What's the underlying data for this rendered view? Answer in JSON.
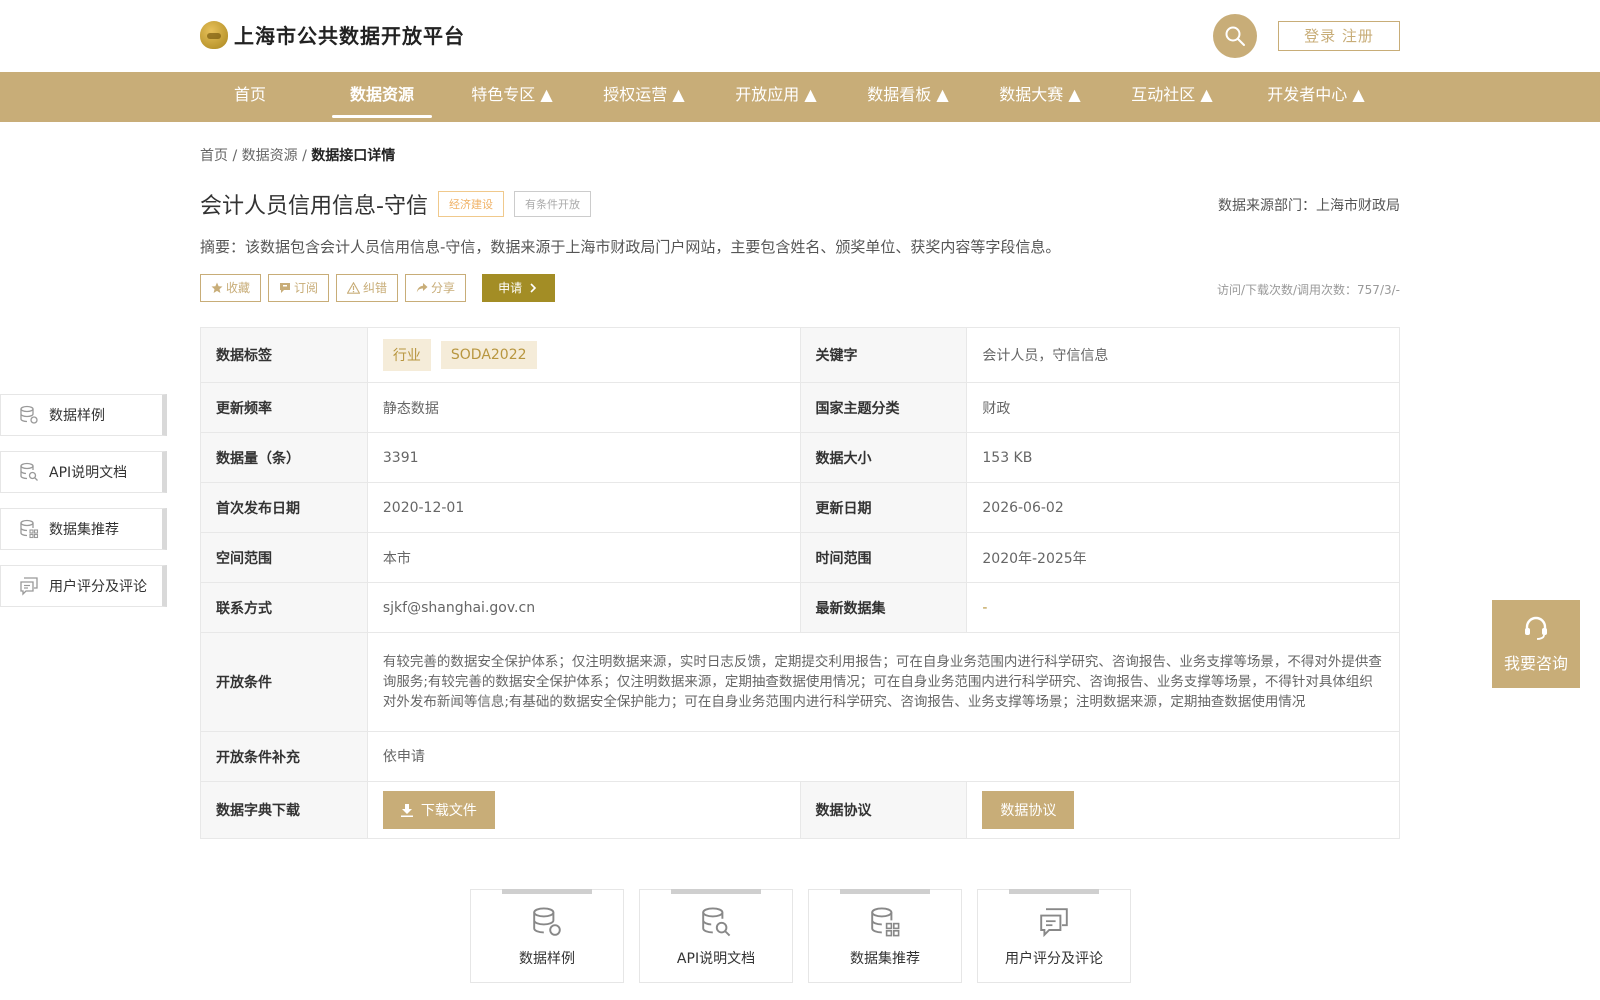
{
  "header": {
    "logo_text": "上海市公共数据开放平台",
    "login_label": "登录 注册"
  },
  "nav": [
    {
      "label": "首页"
    },
    {
      "label": "数据资源"
    },
    {
      "label": "特色专区 ▲"
    },
    {
      "label": "授权运营 ▲"
    },
    {
      "label": "开放应用 ▲"
    },
    {
      "label": "数据看板 ▲"
    },
    {
      "label": "数据大赛 ▲"
    },
    {
      "label": "互动社区 ▲"
    },
    {
      "label": "开发者中心 ▲"
    }
  ],
  "breadcrumb": {
    "home": "首页",
    "sep": " / ",
    "resources": "数据资源",
    "current": "数据接口详情"
  },
  "dataset": {
    "title": "会计人员信用信息-守信",
    "tag_category": "经济建设",
    "tag_open": "有条件开放",
    "source_dept": "数据来源部门：上海市财政局",
    "summary": "摘要：该数据包含会计人员信用信息-守信，数据来源于上海市财政局门户网站，主要包含姓名、颁奖单位、获奖内容等字段信息。",
    "stats": "访问/下载次数/调用次数：757/3/-"
  },
  "actions": {
    "favorite": "收藏",
    "subscribe": "订阅",
    "report": "纠错",
    "share": "分享",
    "apply": "申请"
  },
  "detail": {
    "tags_label": "数据标签",
    "tags": [
      "行业",
      "SODA2022"
    ],
    "keyword_label": "关键字",
    "keyword_value": "会计人员，守信信息",
    "freq_label": "更新频率",
    "freq_value": "静态数据",
    "theme_label": "国家主题分类",
    "theme_value": "财政",
    "count_label": "数据量（条）",
    "count_value": "3391",
    "size_label": "数据大小",
    "size_value": "153 KB",
    "first_pub_label": "首次发布日期",
    "first_pub_value": "2020-12-01",
    "update_label": "更新日期",
    "update_value": "2026-06-02",
    "space_label": "空间范围",
    "space_value": "本市",
    "time_label": "时间范围",
    "time_value": "2020年-2025年",
    "contact_label": "联系方式",
    "contact_value": "sjkf@shanghai.gov.cn",
    "latest_label": "最新数据集",
    "latest_value": "-",
    "conditions_label": "开放条件",
    "conditions_value": "有较完善的数据安全保护体系；仅注明数据来源，实时日志反馈，定期提交利用报告；可在自身业务范围内进行科学研究、咨询报告、业务支撑等场景，不得对外提供查询服务;有较完善的数据安全保护体系；仅注明数据来源，定期抽查数据使用情况；可在自身业务范围内进行科学研究、咨询报告、业务支撑等场景，不得针对具体组织对外发布新闻等信息;有基础的数据安全保护能力；可在自身业务范围内进行科学研究、咨询报告、业务支撑等场景；注明数据来源，定期抽查数据使用情况",
    "cond_extra_label": "开放条件补充",
    "cond_extra_value": "依申请",
    "dict_label": "数据字典下载",
    "dict_button": "下载文件",
    "agreement_label": "数据协议",
    "agreement_button": "数据协议"
  },
  "side_nav": [
    "数据样例",
    "API说明文档",
    "数据集推荐",
    "用户评分及评论"
  ],
  "consult": {
    "label": "我要咨询"
  },
  "bottom_cards": [
    "数据样例",
    "API说明文档",
    "数据集推荐",
    "用户评分及评论"
  ]
}
